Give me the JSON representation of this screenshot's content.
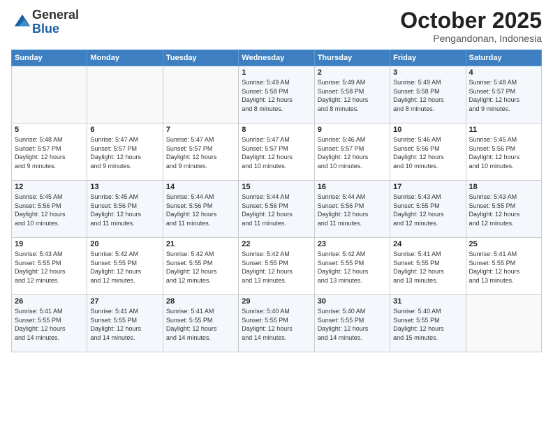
{
  "header": {
    "logo_general": "General",
    "logo_blue": "Blue",
    "month_title": "October 2025",
    "location": "Pengandonan, Indonesia"
  },
  "days_of_week": [
    "Sunday",
    "Monday",
    "Tuesday",
    "Wednesday",
    "Thursday",
    "Friday",
    "Saturday"
  ],
  "weeks": [
    [
      {
        "day": "",
        "info": ""
      },
      {
        "day": "",
        "info": ""
      },
      {
        "day": "",
        "info": ""
      },
      {
        "day": "1",
        "info": "Sunrise: 5:49 AM\nSunset: 5:58 PM\nDaylight: 12 hours\nand 8 minutes."
      },
      {
        "day": "2",
        "info": "Sunrise: 5:49 AM\nSunset: 5:58 PM\nDaylight: 12 hours\nand 8 minutes."
      },
      {
        "day": "3",
        "info": "Sunrise: 5:49 AM\nSunset: 5:58 PM\nDaylight: 12 hours\nand 8 minutes."
      },
      {
        "day": "4",
        "info": "Sunrise: 5:48 AM\nSunset: 5:57 PM\nDaylight: 12 hours\nand 9 minutes."
      }
    ],
    [
      {
        "day": "5",
        "info": "Sunrise: 5:48 AM\nSunset: 5:57 PM\nDaylight: 12 hours\nand 9 minutes."
      },
      {
        "day": "6",
        "info": "Sunrise: 5:47 AM\nSunset: 5:57 PM\nDaylight: 12 hours\nand 9 minutes."
      },
      {
        "day": "7",
        "info": "Sunrise: 5:47 AM\nSunset: 5:57 PM\nDaylight: 12 hours\nand 9 minutes."
      },
      {
        "day": "8",
        "info": "Sunrise: 5:47 AM\nSunset: 5:57 PM\nDaylight: 12 hours\nand 10 minutes."
      },
      {
        "day": "9",
        "info": "Sunrise: 5:46 AM\nSunset: 5:57 PM\nDaylight: 12 hours\nand 10 minutes."
      },
      {
        "day": "10",
        "info": "Sunrise: 5:46 AM\nSunset: 5:56 PM\nDaylight: 12 hours\nand 10 minutes."
      },
      {
        "day": "11",
        "info": "Sunrise: 5:45 AM\nSunset: 5:56 PM\nDaylight: 12 hours\nand 10 minutes."
      }
    ],
    [
      {
        "day": "12",
        "info": "Sunrise: 5:45 AM\nSunset: 5:56 PM\nDaylight: 12 hours\nand 10 minutes."
      },
      {
        "day": "13",
        "info": "Sunrise: 5:45 AM\nSunset: 5:56 PM\nDaylight: 12 hours\nand 11 minutes."
      },
      {
        "day": "14",
        "info": "Sunrise: 5:44 AM\nSunset: 5:56 PM\nDaylight: 12 hours\nand 11 minutes."
      },
      {
        "day": "15",
        "info": "Sunrise: 5:44 AM\nSunset: 5:56 PM\nDaylight: 12 hours\nand 11 minutes."
      },
      {
        "day": "16",
        "info": "Sunrise: 5:44 AM\nSunset: 5:56 PM\nDaylight: 12 hours\nand 11 minutes."
      },
      {
        "day": "17",
        "info": "Sunrise: 5:43 AM\nSunset: 5:55 PM\nDaylight: 12 hours\nand 12 minutes."
      },
      {
        "day": "18",
        "info": "Sunrise: 5:43 AM\nSunset: 5:55 PM\nDaylight: 12 hours\nand 12 minutes."
      }
    ],
    [
      {
        "day": "19",
        "info": "Sunrise: 5:43 AM\nSunset: 5:55 PM\nDaylight: 12 hours\nand 12 minutes."
      },
      {
        "day": "20",
        "info": "Sunrise: 5:42 AM\nSunset: 5:55 PM\nDaylight: 12 hours\nand 12 minutes."
      },
      {
        "day": "21",
        "info": "Sunrise: 5:42 AM\nSunset: 5:55 PM\nDaylight: 12 hours\nand 12 minutes."
      },
      {
        "day": "22",
        "info": "Sunrise: 5:42 AM\nSunset: 5:55 PM\nDaylight: 12 hours\nand 13 minutes."
      },
      {
        "day": "23",
        "info": "Sunrise: 5:42 AM\nSunset: 5:55 PM\nDaylight: 12 hours\nand 13 minutes."
      },
      {
        "day": "24",
        "info": "Sunrise: 5:41 AM\nSunset: 5:55 PM\nDaylight: 12 hours\nand 13 minutes."
      },
      {
        "day": "25",
        "info": "Sunrise: 5:41 AM\nSunset: 5:55 PM\nDaylight: 12 hours\nand 13 minutes."
      }
    ],
    [
      {
        "day": "26",
        "info": "Sunrise: 5:41 AM\nSunset: 5:55 PM\nDaylight: 12 hours\nand 14 minutes."
      },
      {
        "day": "27",
        "info": "Sunrise: 5:41 AM\nSunset: 5:55 PM\nDaylight: 12 hours\nand 14 minutes."
      },
      {
        "day": "28",
        "info": "Sunrise: 5:41 AM\nSunset: 5:55 PM\nDaylight: 12 hours\nand 14 minutes."
      },
      {
        "day": "29",
        "info": "Sunrise: 5:40 AM\nSunset: 5:55 PM\nDaylight: 12 hours\nand 14 minutes."
      },
      {
        "day": "30",
        "info": "Sunrise: 5:40 AM\nSunset: 5:55 PM\nDaylight: 12 hours\nand 14 minutes."
      },
      {
        "day": "31",
        "info": "Sunrise: 5:40 AM\nSunset: 5:55 PM\nDaylight: 12 hours\nand 15 minutes."
      },
      {
        "day": "",
        "info": ""
      }
    ]
  ]
}
